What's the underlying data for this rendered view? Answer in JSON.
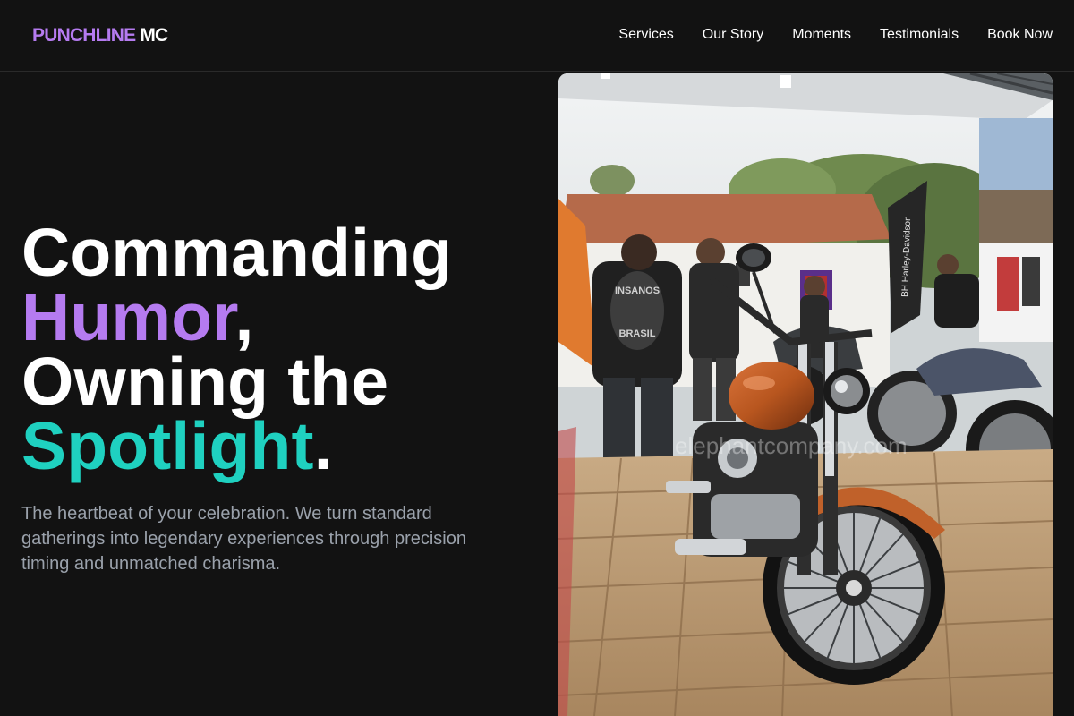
{
  "brand": {
    "part1": "PUNCHLINE",
    "part2": "MC"
  },
  "nav": [
    "Services",
    "Our Story",
    "Moments",
    "Testimonials",
    "Book Now"
  ],
  "hero": {
    "line1": "Commanding",
    "line2_highlight": "Humor",
    "line2_punct": ",",
    "line3": "Owning the",
    "line4_highlight": "Spotlight",
    "line4_punct": ".",
    "description": "The heartbeat of your celebration. We turn standard gatherings into legendary experiences through precision timing and unmatched charisma."
  },
  "photo": {
    "subject": "motorcycle-exhibition-photo",
    "jacket_patch_top": "INSANOS",
    "jacket_patch_bottom": "BRASIL",
    "banner_text": "BH Harley-Davidson",
    "watermark": "elephantcompany.com"
  },
  "colors": {
    "purple": "#b57bf0",
    "teal": "#1fd1c0",
    "background": "#121212",
    "muted_text": "#9aa1ab"
  }
}
